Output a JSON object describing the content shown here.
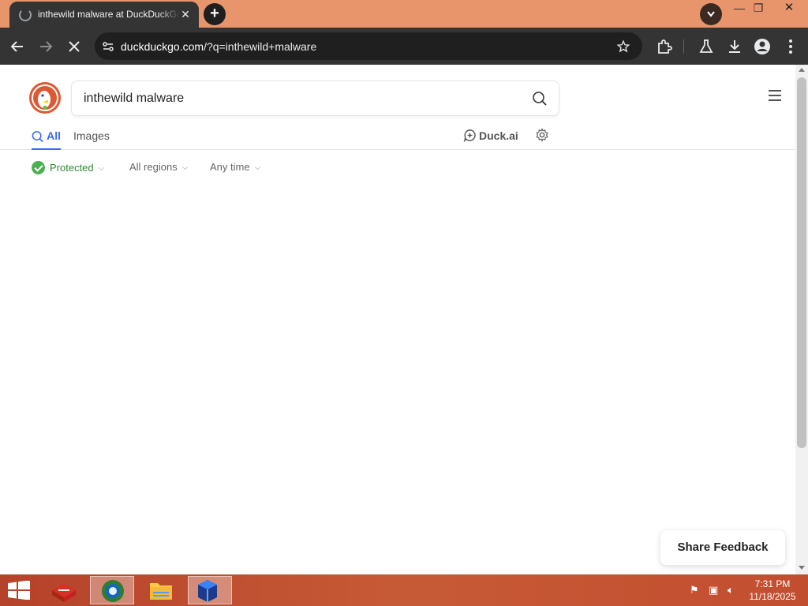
{
  "browser": {
    "tab_title": "inthewild malware at DuckDuckGo",
    "tab_close": "✕",
    "new_tab": "+",
    "window": {
      "minimize": "—",
      "restore": "❐",
      "close": "✕"
    },
    "url_host": "duckduckgo.com",
    "url_path": "/?q=inthewild+malware",
    "icons": [
      "back-icon",
      "forward-icon",
      "stop-icon",
      "site-info-icon",
      "bookmark-star-icon",
      "extensions-icon",
      "labs-flask-icon",
      "download-icon",
      "profile-icon",
      "menu-dots-icon"
    ]
  },
  "page": {
    "search_query": "inthewild malware",
    "tabs": {
      "all": "All",
      "images": "Images"
    },
    "duck_ai": "Duck.ai",
    "filters": {
      "protected": "Protected",
      "regions": "All regions",
      "time": "Any time"
    },
    "feedback": "Share Feedback"
  },
  "taskbar": {
    "time": "7:31 PM",
    "date": "11/18/2025"
  },
  "colors": {
    "accent": "#3969ef",
    "brand": "#de5833",
    "protected": "#2f8a30",
    "tabstrip": "#e8956c"
  }
}
